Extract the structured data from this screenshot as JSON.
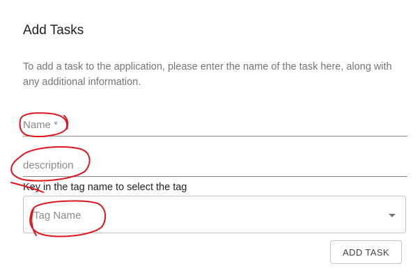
{
  "dialog": {
    "title": "Add Tasks",
    "description": "To add a task to the application, please enter the name of the task here, along with any additional information."
  },
  "fields": {
    "name_placeholder": "Name *",
    "description_placeholder": "description"
  },
  "tag": {
    "helper_text": "Key in the tag name to select the tag",
    "placeholder": "Tag Name"
  },
  "actions": {
    "add_task_label": "ADD TASK"
  },
  "annotation": {
    "color": "#e0141b"
  }
}
